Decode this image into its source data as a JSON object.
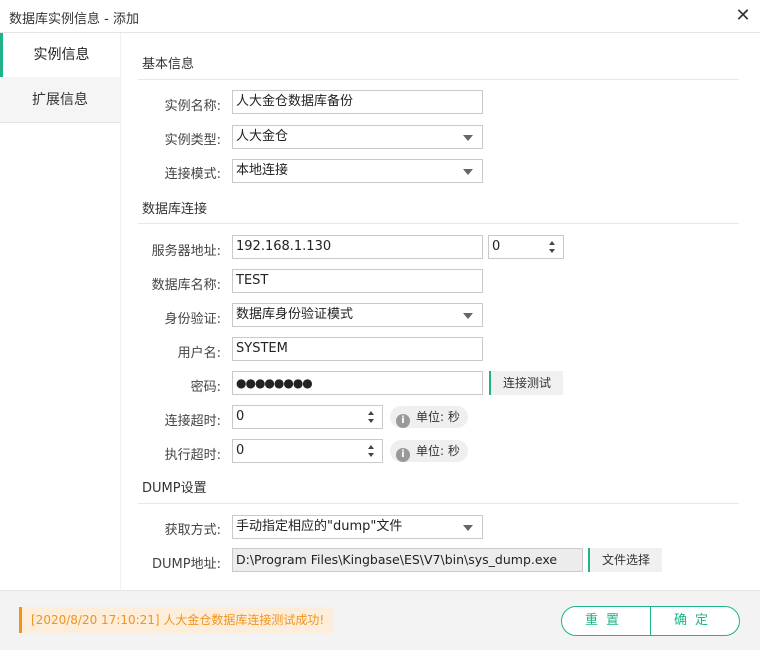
{
  "window": {
    "title": "数据库实例信息 - 添加",
    "close_glyph": "✕"
  },
  "tabs": [
    {
      "label": "实例信息",
      "active": true
    },
    {
      "label": "扩展信息",
      "active": false
    }
  ],
  "sections": {
    "basic": "基本信息",
    "connection": "数据库连接",
    "dump": "DUMP设置"
  },
  "basic": {
    "instance_name": {
      "label": "实例名称:",
      "value": "人大金仓数据库备份"
    },
    "instance_type": {
      "label": "实例类型:",
      "value": "人大金仓"
    },
    "connect_mode": {
      "label": "连接模式:",
      "value": "本地连接"
    }
  },
  "connection": {
    "server": {
      "label": "服务器地址:",
      "value": "192.168.1.130",
      "port": "0"
    },
    "db_name": {
      "label": "数据库名称:",
      "value": "TEST"
    },
    "auth": {
      "label": "身份验证:",
      "value": "数据库身份验证模式"
    },
    "username": {
      "label": "用户名:",
      "value": "SYSTEM"
    },
    "password": {
      "label": "密码:",
      "value": "●●●●●●●●",
      "test_button": "连接测试"
    },
    "connect_timeout": {
      "label": "连接超时:",
      "value": "0",
      "unit": "单位: 秒"
    },
    "exec_timeout": {
      "label": "执行超时:",
      "value": "0",
      "unit": "单位: 秒"
    }
  },
  "dump": {
    "method": {
      "label": "获取方式:",
      "value": "手动指定相应的\"dump\"文件"
    },
    "path": {
      "label": "DUMP地址:",
      "value": "D:\\Program Files\\Kingbase\\ES\\V7\\bin\\sys_dump.exe",
      "select_button": "文件选择"
    }
  },
  "footer": {
    "status": "[2020/8/20  17:10:21] 人大金仓数据库连接测试成功!",
    "reset_label": "重置",
    "confirm_label": "确定"
  },
  "colors": {
    "accent": "#1fb38a",
    "status_text": "#f0941e",
    "status_bg": "#fdeedb"
  },
  "icons": {
    "close": "close-icon",
    "dropdown": "chevron-down-icon",
    "spinner": "spinner-arrows-icon",
    "info": "info-icon"
  }
}
